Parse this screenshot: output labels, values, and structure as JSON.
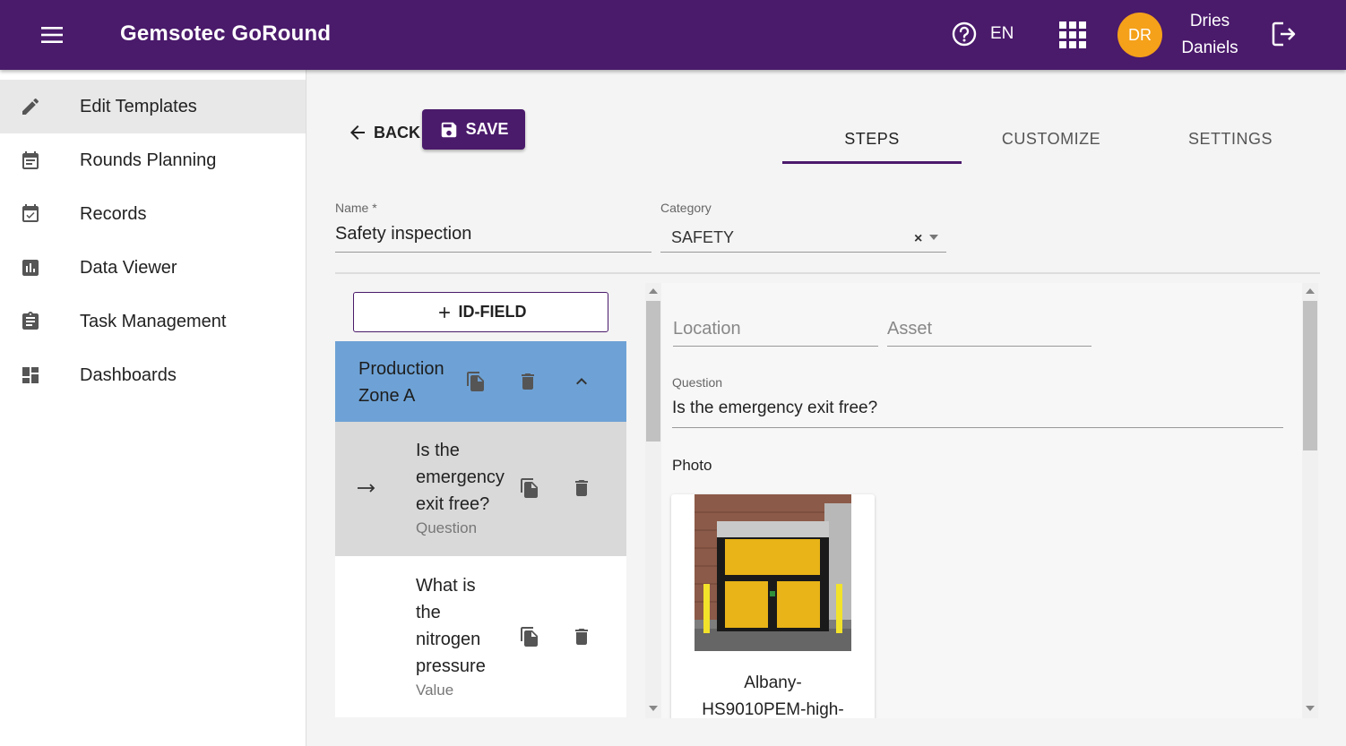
{
  "app": {
    "title": "Gemsotec GoRound",
    "language": "EN",
    "user_initials": "DR",
    "user_first_name": "Dries",
    "user_last_name": "Daniels",
    "brand_color": "#4a1a6b",
    "avatar_color": "#f5a11a"
  },
  "sidebar": {
    "items": [
      {
        "label": "Edit Templates",
        "icon": "pencil-icon",
        "active": true
      },
      {
        "label": "Rounds Planning",
        "icon": "calendar-icon"
      },
      {
        "label": "Records",
        "icon": "calendar-check-icon"
      },
      {
        "label": "Data Viewer",
        "icon": "bar-chart-icon"
      },
      {
        "label": "Task Management",
        "icon": "clipboard-icon"
      },
      {
        "label": "Dashboards",
        "icon": "dashboard-icon"
      }
    ]
  },
  "toolbar": {
    "back_label": "BACK",
    "save_label": "SAVE"
  },
  "tabs": [
    {
      "label": "STEPS",
      "active": true
    },
    {
      "label": "CUSTOMIZE"
    },
    {
      "label": "SETTINGS"
    }
  ],
  "form": {
    "name_label": "Name *",
    "name_value": "Safety inspection",
    "category_label": "Category",
    "category_value": "SAFETY",
    "clear_symbol": "×"
  },
  "steps": {
    "add_button_label": "ID-FIELD",
    "group": {
      "label_line1": "Production",
      "label_line2": "Zone A",
      "color": "#6ea2d6"
    },
    "items": [
      {
        "lines": [
          "Is the",
          "emergency",
          "exit free?"
        ],
        "type": "Question",
        "selected": true
      },
      {
        "lines": [
          "What is",
          "the",
          "nitrogen",
          "pressure"
        ],
        "type": "Value"
      }
    ]
  },
  "detail": {
    "location_placeholder": "Location",
    "asset_placeholder": "Asset",
    "question_label": "Question",
    "question_value": "Is the emergency exit free?",
    "photo_label": "Photo",
    "photo_caption_line1": "Albany-",
    "photo_caption_line2": "HS9010PEM-high-"
  }
}
